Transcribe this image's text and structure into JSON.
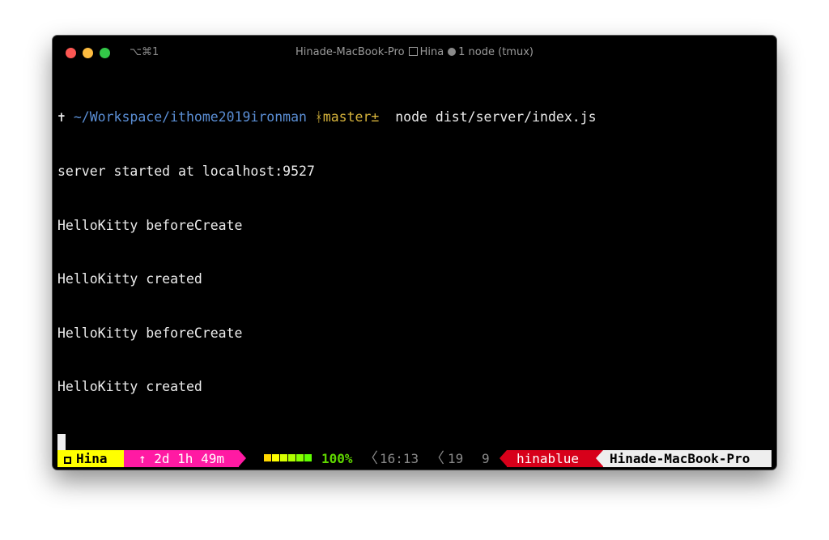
{
  "window": {
    "shortcut": "⌥⌘1",
    "title_host": "Hinade-MacBook-Pro",
    "title_session": "Hina",
    "title_window": "1 node (tmux)"
  },
  "prompt": {
    "symbol": "✝",
    "path": "~/Workspace/ithome2019ironman",
    "branch_icon": "git-branch-icon",
    "branch": "master±",
    "command": "node dist/server/index.js"
  },
  "output": [
    "server started at localhost:9527",
    "HelloKitty beforeCreate",
    "HelloKitty created",
    "HelloKitty beforeCreate",
    "HelloKitty created"
  ],
  "statusbar": {
    "session": "Hina",
    "uptime": "↑ 2d 1h 49m",
    "battery_percent": "100%",
    "battery_level": 1.0,
    "time": "16:13",
    "day": "19",
    "month": "9",
    "user": "hinablue",
    "host": "Hinade-MacBook-Pro",
    "colors": {
      "session_bg": "#ffff00",
      "uptime_bg": "#ff1aa3",
      "user_bg": "#d7001a",
      "host_bg": "#eeeeee",
      "battery": "#5fd700"
    }
  },
  "colors": {
    "path": "#5b8fd6",
    "branch": "#d7b43c",
    "text": "#ececec"
  }
}
